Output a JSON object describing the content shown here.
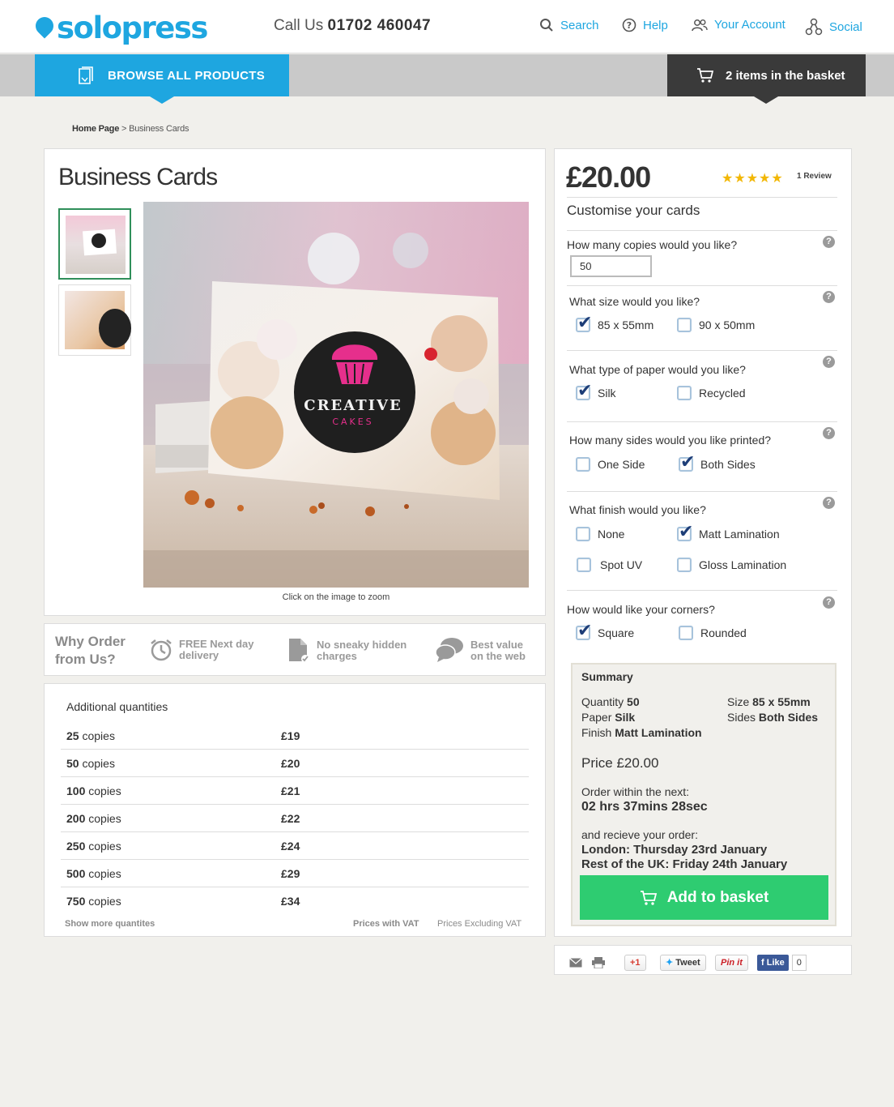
{
  "header": {
    "brand": "solopress",
    "phone_prefix": "Call Us",
    "phone_number": "01702 460047",
    "nav": {
      "search": "Search",
      "help": "Help",
      "account": "Your Account",
      "social": "Social"
    }
  },
  "bar": {
    "browse": "BROWSE ALL PRODUCTS",
    "basket": "2 items in the basket"
  },
  "breadcrumb": {
    "home": "Home Page",
    "separator": ">",
    "current": "Business Cards"
  },
  "product": {
    "title": "Business Cards",
    "zoom_note": "Click on the image to zoom",
    "card_text_1": "CREATIVE",
    "card_text_2": "CAKES"
  },
  "why": {
    "title_1": "Why Order",
    "title_2": "from Us?",
    "items": [
      {
        "line1": "FREE Next day",
        "line2": "delivery"
      },
      {
        "line1": "No sneaky hidden",
        "line2": "charges"
      },
      {
        "line1": "Best value",
        "line2": "on the web"
      }
    ]
  },
  "quantities": {
    "heading": "Additional quantities",
    "unit": "copies",
    "rows": [
      {
        "qty": "25",
        "price": "£19"
      },
      {
        "qty": "50",
        "price": "£20"
      },
      {
        "qty": "100",
        "price": "£21"
      },
      {
        "qty": "200",
        "price": "£22"
      },
      {
        "qty": "250",
        "price": "£24"
      },
      {
        "qty": "500",
        "price": "£29"
      },
      {
        "qty": "750",
        "price": "£34"
      }
    ],
    "show_more": "Show more quantites",
    "vat_with": "Prices with VAT",
    "vat_excl": "Prices Excluding VAT"
  },
  "order": {
    "price": "£20.00",
    "rating": 5,
    "reviews": "1 Review",
    "customise_title": "Customise your cards",
    "help_glyph": "?",
    "copies_label": "How many copies would you like?",
    "copies_value": "50",
    "size_label": "What size would you like?",
    "size_options": [
      "85 x 55mm",
      "90 x 50mm"
    ],
    "paper_label": "What type of paper would you like?",
    "paper_options": [
      "Silk",
      "Recycled"
    ],
    "sides_label": "How many sides would you like printed?",
    "sides_options": [
      "One Side",
      "Both Sides"
    ],
    "finish_label": "What finish would you like?",
    "finish_options": [
      "None",
      "Matt Lamination",
      "Spot UV",
      "Gloss Lamination"
    ],
    "corners_label": "How would like your corners?",
    "corners_options": [
      "Square",
      "Rounded"
    ]
  },
  "summary": {
    "title": "Summary",
    "quantity_label": "Quantity",
    "quantity_value": "50",
    "size_label": "Size",
    "size_value": "85 x 55mm",
    "paper_label": "Paper",
    "paper_value": "Silk",
    "sides_label": "Sides",
    "sides_value": "Both Sides",
    "finish_label": "Finish",
    "finish_value": "Matt Lamination",
    "price": "Price £20.00",
    "order_within": "Order within the next:",
    "countdown": "02 hrs 37mins 28sec",
    "receive": "and recieve your order:",
    "london": "London: Thursday 23rd January",
    "rest_uk": "Rest of the UK: Friday 24th January",
    "add_to_basket": "Add to basket"
  },
  "share": {
    "gplus": "+1",
    "tweet": "Tweet",
    "pinit": "Pin it",
    "like": "Like",
    "like_count": "0"
  },
  "colors": {
    "brand_blue": "#1ea6e0",
    "basket_dark": "#3a3a3a",
    "cta_green": "#2ecc71",
    "star": "#f2b705"
  }
}
